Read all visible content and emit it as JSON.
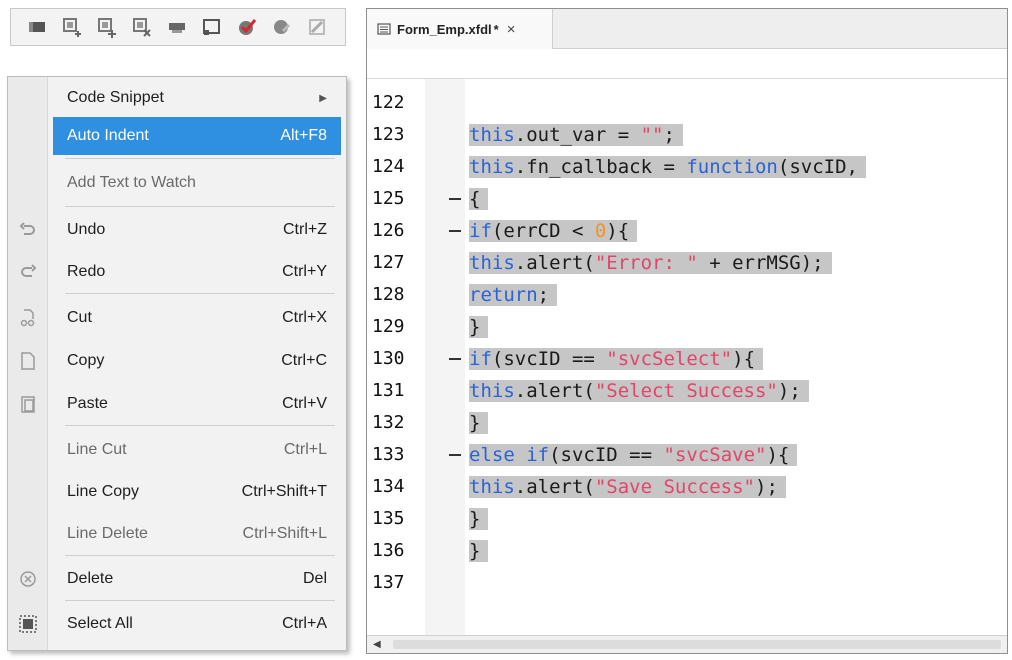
{
  "toolbar": {
    "buttons": [
      {
        "icon": "comment-block-icon"
      },
      {
        "icon": "breakpoint-add-icon"
      },
      {
        "icon": "breakpoint-add-all-icon"
      },
      {
        "icon": "breakpoint-remove-icon"
      },
      {
        "icon": "watch-icon"
      },
      {
        "icon": "window-icon"
      },
      {
        "icon": "validate-check-icon"
      },
      {
        "icon": "clear-icon"
      },
      {
        "icon": "disabled-tool-icon"
      }
    ]
  },
  "menu": {
    "items": [
      {
        "label": "Code Snippet",
        "shortcut": "",
        "submenu": true,
        "disabled": false,
        "active": false
      },
      {
        "label": "Auto Indent",
        "shortcut": "Alt+F8",
        "disabled": false,
        "active": true
      },
      {
        "label": "Add Text to Watch",
        "shortcut": "",
        "disabled": true,
        "active": false
      },
      {
        "label": "Undo",
        "shortcut": "Ctrl+Z",
        "disabled": false,
        "active": false,
        "icon": "undo-icon"
      },
      {
        "label": "Redo",
        "shortcut": "Ctrl+Y",
        "disabled": false,
        "active": false,
        "icon": "redo-icon"
      },
      {
        "label": "Cut",
        "shortcut": "Ctrl+X",
        "disabled": false,
        "active": false,
        "icon": "cut-icon"
      },
      {
        "label": "Copy",
        "shortcut": "Ctrl+C",
        "disabled": false,
        "active": false,
        "icon": "copy-icon"
      },
      {
        "label": "Paste",
        "shortcut": "Ctrl+V",
        "disabled": false,
        "active": false,
        "icon": "paste-icon"
      },
      {
        "label": "Line Cut",
        "shortcut": "Ctrl+L",
        "disabled": true,
        "active": false
      },
      {
        "label": "Line Copy",
        "shortcut": "Ctrl+Shift+T",
        "disabled": false,
        "active": false
      },
      {
        "label": "Line Delete",
        "shortcut": "Ctrl+Shift+L",
        "disabled": true,
        "active": false
      },
      {
        "label": "Delete",
        "shortcut": "Del",
        "disabled": false,
        "active": false,
        "icon": "delete-icon"
      },
      {
        "label": "Select All",
        "shortcut": "Ctrl+A",
        "disabled": false,
        "active": false,
        "icon": "select-all-icon"
      }
    ]
  },
  "editor": {
    "tab": {
      "filename": "Form_Emp.xfdl",
      "modified_marker": "*",
      "close_label": "×"
    },
    "lines": [
      {
        "num": "122",
        "fold": false,
        "selected": false,
        "tokens": []
      },
      {
        "num": "123",
        "fold": false,
        "selected": true,
        "tokens": [
          [
            "kw",
            "this"
          ],
          [
            "t",
            ".out_var = "
          ],
          [
            "str",
            "\"\""
          ],
          [
            "t",
            ";"
          ]
        ]
      },
      {
        "num": "124",
        "fold": false,
        "selected": true,
        "tokens": [
          [
            "kw",
            "this"
          ],
          [
            "t",
            ".fn_callback = "
          ],
          [
            "kw",
            "function"
          ],
          [
            "t",
            "(svcID,"
          ]
        ]
      },
      {
        "num": "125",
        "fold": true,
        "selected": true,
        "tokens": [
          [
            "t",
            "{"
          ]
        ]
      },
      {
        "num": "126",
        "fold": true,
        "selected": true,
        "tokens": [
          [
            "kw",
            "if"
          ],
          [
            "t",
            "(errCD < "
          ],
          [
            "num",
            "0"
          ],
          [
            "t",
            "){"
          ]
        ]
      },
      {
        "num": "127",
        "fold": false,
        "selected": true,
        "tokens": [
          [
            "kw",
            "this"
          ],
          [
            "t",
            ".alert("
          ],
          [
            "str",
            "\"Error: \""
          ],
          [
            "t",
            " + errMSG);"
          ]
        ]
      },
      {
        "num": "128",
        "fold": false,
        "selected": true,
        "tokens": [
          [
            "kw",
            "return"
          ],
          [
            "t",
            ";"
          ]
        ]
      },
      {
        "num": "129",
        "fold": false,
        "selected": true,
        "tokens": [
          [
            "t",
            "}"
          ]
        ]
      },
      {
        "num": "130",
        "fold": true,
        "selected": true,
        "tokens": [
          [
            "kw",
            "if"
          ],
          [
            "t",
            "(svcID == "
          ],
          [
            "str",
            "\"svcSelect\""
          ],
          [
            "t",
            "){"
          ]
        ]
      },
      {
        "num": "131",
        "fold": false,
        "selected": true,
        "tokens": [
          [
            "kw",
            "this"
          ],
          [
            "t",
            ".alert("
          ],
          [
            "str",
            "\"Select Success\""
          ],
          [
            "t",
            ");"
          ]
        ]
      },
      {
        "num": "132",
        "fold": false,
        "selected": true,
        "tokens": [
          [
            "t",
            "}"
          ]
        ]
      },
      {
        "num": "133",
        "fold": true,
        "selected": true,
        "tokens": [
          [
            "kw",
            "else"
          ],
          [
            "t",
            " "
          ],
          [
            "kw",
            "if"
          ],
          [
            "t",
            "(svcID == "
          ],
          [
            "str",
            "\"svcSave\""
          ],
          [
            "t",
            "){"
          ]
        ]
      },
      {
        "num": "134",
        "fold": false,
        "selected": true,
        "tokens": [
          [
            "kw",
            "this"
          ],
          [
            "t",
            ".alert("
          ],
          [
            "str",
            "\"Save Success\""
          ],
          [
            "t",
            ");"
          ]
        ]
      },
      {
        "num": "135",
        "fold": false,
        "selected": true,
        "tokens": [
          [
            "t",
            "}"
          ]
        ]
      },
      {
        "num": "136",
        "fold": false,
        "selected": true,
        "tokens": [
          [
            "t",
            "}"
          ]
        ]
      },
      {
        "num": "137",
        "fold": false,
        "selected": false,
        "tokens": []
      }
    ]
  },
  "colors": {
    "keyword": "#2a63d6",
    "string": "#e3446a",
    "number": "#f0932b",
    "selection": "#c6c6c6",
    "menu_active": "#2f8fe0"
  }
}
